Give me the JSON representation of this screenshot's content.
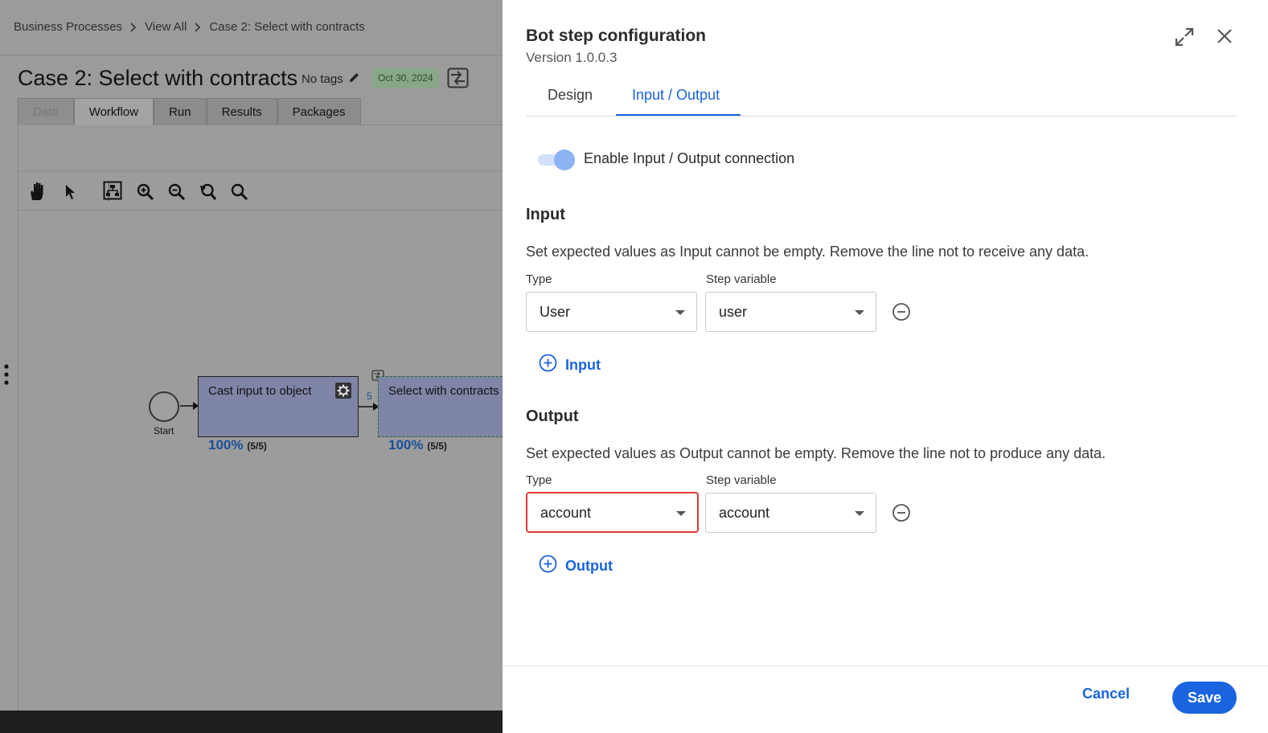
{
  "background": {
    "breadcrumb": [
      "Business Processes",
      "View All",
      "Case 2: Select with contracts"
    ],
    "case_title": "Case 2: Select with contracts",
    "tags_label": "No tags",
    "date_badge": "Oct 30, 2024",
    "tabs": [
      "Data",
      "Workflow",
      "Run",
      "Results",
      "Packages"
    ],
    "active_tab": "Workflow",
    "workflow": {
      "start_label": "Start",
      "nodes": [
        {
          "title": "Cast input to object",
          "percent": "100%",
          "count": "(5/5)"
        },
        {
          "title": "Select with contracts",
          "percent": "100%",
          "count": "(5/5)"
        }
      ],
      "edge_count_label": "5"
    }
  },
  "drawer": {
    "title": "Bot step configuration",
    "version": "Version 1.0.0.3",
    "tabs": [
      "Design",
      "Input / Output"
    ],
    "active_tab": "Input / Output",
    "toggle": {
      "label": "Enable Input / Output connection",
      "enabled": true
    },
    "input": {
      "title": "Input",
      "description": "Set expected values as Input cannot be empty. Remove the line not to receive any data.",
      "type_label": "Type",
      "variable_label": "Step variable",
      "row": {
        "type": "User",
        "variable": "user"
      },
      "add_label": "Input"
    },
    "output": {
      "title": "Output",
      "description": "Set expected values as Output cannot be empty. Remove the line not to produce any data.",
      "type_label": "Type",
      "variable_label": "Step variable",
      "row": {
        "type": "account",
        "variable": "account"
      },
      "add_label": "Output"
    },
    "cancel_label": "Cancel",
    "save_label": "Save"
  },
  "colors": {
    "accent": "#1a64e0",
    "focus_border": "#e53935",
    "badge_bg": "#87a887"
  }
}
